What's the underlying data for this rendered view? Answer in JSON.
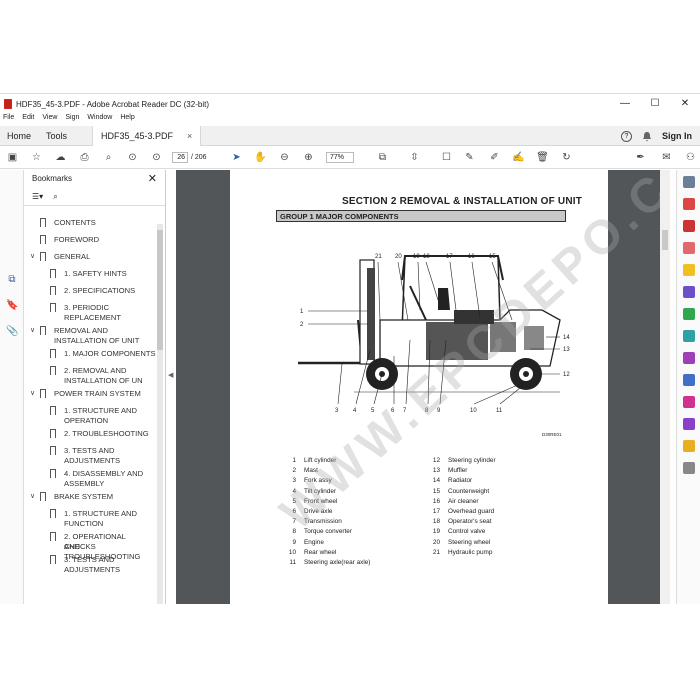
{
  "window": {
    "title": "HDF35_45-3.PDF - Adobe Acrobat Reader DC (32-bit)",
    "controls": [
      "—",
      "☐",
      "✕"
    ]
  },
  "menu": [
    "File",
    "Edit",
    "View",
    "Sign",
    "Window",
    "Help"
  ],
  "tabs": {
    "home": "Home",
    "tools": "Tools",
    "document": "HDF35_45-3.PDF",
    "close": "×"
  },
  "header_right": {
    "help": "?",
    "sign_in": "Sign In"
  },
  "toolbar": {
    "page_current": "26",
    "page_total": "/ 206",
    "zoom": "77%"
  },
  "bookmarks": {
    "title": "Bookmarks",
    "items": [
      {
        "label": "CONTENTS",
        "level": 0,
        "expander": ""
      },
      {
        "label": "FOREWORD",
        "level": 0,
        "expander": ""
      },
      {
        "label": "GENERAL",
        "level": 0,
        "expander": "∨"
      },
      {
        "label": "1. SAFETY HINTS",
        "level": 1,
        "expander": ""
      },
      {
        "label": "2. SPECIFICATIONS",
        "level": 1,
        "expander": ""
      },
      {
        "label": "3. PERIODIC",
        "label2": "REPLACEMENT",
        "level": 1,
        "expander": ""
      },
      {
        "label": "REMOVAL AND",
        "label2": "INSTALLATION OF UNIT",
        "level": 0,
        "expander": "∨"
      },
      {
        "label": "1. MAJOR COMPONENTS",
        "level": 1,
        "expander": ""
      },
      {
        "label": "2. REMOVAL AND",
        "label2": "INSTALLATION OF UN",
        "level": 1,
        "expander": ""
      },
      {
        "label": "POWER TRAIN SYSTEM",
        "level": 0,
        "expander": "∨"
      },
      {
        "label": "1. STRUCTURE AND",
        "label2": "OPERATION",
        "level": 1,
        "expander": ""
      },
      {
        "label": "2. TROUBLESHOOTING",
        "level": 1,
        "expander": ""
      },
      {
        "label": "3. TESTS AND",
        "label2": "ADJUSTMENTS",
        "level": 1,
        "expander": ""
      },
      {
        "label": "4. DISASSEMBLY AND",
        "label2": "ASSEMBLY",
        "level": 1,
        "expander": ""
      },
      {
        "label": "BRAKE SYSTEM",
        "level": 0,
        "expander": "∨"
      },
      {
        "label": "1. STRUCTURE AND",
        "label2": "FUNCTION",
        "level": 1,
        "expander": ""
      },
      {
        "label": "2. OPERATIONAL CHECKS",
        "label2": "AND TROUBLESHOOTING",
        "level": 1,
        "expander": ""
      },
      {
        "label": "3. TESTS AND",
        "label2": "ADJUSTMENTS",
        "level": 1,
        "expander": ""
      }
    ]
  },
  "document": {
    "section_title": "SECTION  2  REMOVAL & INSTALLATION OF UNIT",
    "group_title": "GROUP  1  MAJOR COMPONENTS",
    "figure_code": "D30RE01",
    "watermark": "WWW.EPCDEPO.COM",
    "callouts_top": [
      "21",
      "20",
      "19",
      "18",
      "17",
      "16",
      "15"
    ],
    "callouts_left": [
      "1",
      "2"
    ],
    "callouts_right": [
      "14",
      "13",
      "12"
    ],
    "callouts_bottom": [
      "3",
      "4",
      "5",
      "6",
      "7",
      "8",
      "9",
      "10",
      "11"
    ],
    "legend_left": [
      {
        "n": "1",
        "t": "Lift cylinder"
      },
      {
        "n": "2",
        "t": "Mast"
      },
      {
        "n": "3",
        "t": "Fork assy"
      },
      {
        "n": "4",
        "t": "Tilt cylinder"
      },
      {
        "n": "5",
        "t": "Front wheel"
      },
      {
        "n": "6",
        "t": "Drive axle"
      },
      {
        "n": "7",
        "t": "Transmission"
      },
      {
        "n": "8",
        "t": "Torque converter"
      },
      {
        "n": "9",
        "t": "Engine"
      },
      {
        "n": "10",
        "t": "Rear wheel"
      },
      {
        "n": "11",
        "t": "Steering axle(rear axle)"
      }
    ],
    "legend_right": [
      {
        "n": "12",
        "t": "Steering cylinder"
      },
      {
        "n": "13",
        "t": "Muffler"
      },
      {
        "n": "14",
        "t": "Radiator"
      },
      {
        "n": "15",
        "t": "Counterweight"
      },
      {
        "n": "16",
        "t": "Air cleaner"
      },
      {
        "n": "17",
        "t": "Overhead guard"
      },
      {
        "n": "18",
        "t": "Operator's seat"
      },
      {
        "n": "19",
        "t": "Control valve"
      },
      {
        "n": "20",
        "t": "Steering wheel"
      },
      {
        "n": "21",
        "t": "Hydraulic pump"
      }
    ]
  },
  "colors": {
    "accent": "#2f5fa8",
    "app_icon": "#c8201a",
    "viewer_bg": "#525659"
  }
}
